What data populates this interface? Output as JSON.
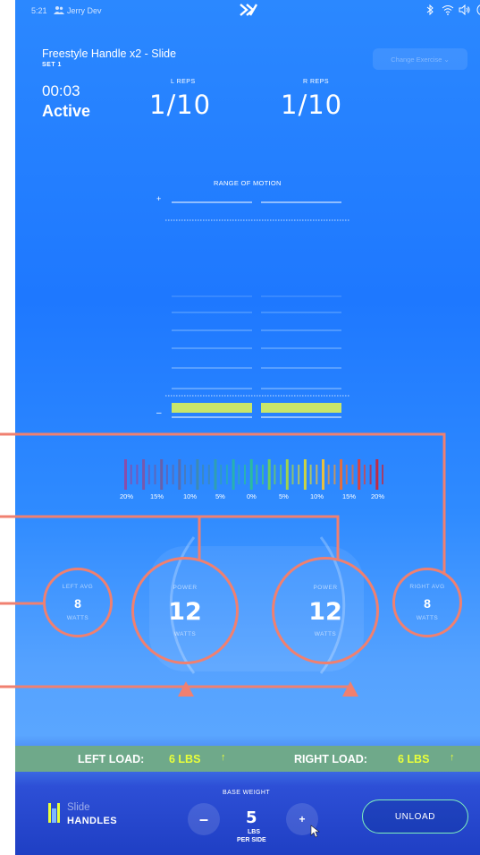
{
  "status_bar": {
    "time": "5:21",
    "user": "Jerry Dev",
    "logo": "X-logo",
    "icons": [
      "bluetooth-icon",
      "wifi-icon",
      "volume-icon",
      "dropdown-circle-icon"
    ]
  },
  "header": {
    "exercise_title": "Freestyle Handle x2 - Slide",
    "set_label": "SET 1",
    "change_exercise": "Change Exercise ⌄",
    "timer": "00:03",
    "state": "Active",
    "left_reps_label": "L REPS",
    "left_reps": "1/10",
    "right_reps_label": "R REPS",
    "right_reps": "1/10"
  },
  "range_of_motion": {
    "title": "RANGE OF MOTION",
    "plus": "+",
    "minus": "–",
    "left_fill": 0.08,
    "right_fill": 0.08
  },
  "balance_scale": {
    "labels": [
      "20%",
      "15%",
      "10%",
      "5%",
      "0%",
      "5%",
      "10%",
      "15%",
      "20%"
    ]
  },
  "metrics": {
    "left_avg": {
      "label": "LEFT AVG",
      "value": "8",
      "unit": "WATTS"
    },
    "left_power": {
      "label": "POWER",
      "value": "12",
      "unit": "WATTS"
    },
    "right_power": {
      "label": "POWER",
      "value": "12",
      "unit": "WATTS"
    },
    "right_avg": {
      "label": "RIGHT AVG",
      "value": "8",
      "unit": "WATTS"
    }
  },
  "load": {
    "left_label": "LEFT LOAD:",
    "left_value": "6 LBS",
    "left_arrow": "↑",
    "right_label": "RIGHT LOAD:",
    "right_value": "6 LBS",
    "right_arrow": "↑"
  },
  "footer": {
    "mode_line1": "Slide",
    "mode_line2": "HANDLES",
    "base_weight_label": "BASE WEIGHT",
    "base_weight_value": "5",
    "unit_line1": "LBS",
    "unit_line2": "PER SIDE",
    "minus": "–",
    "plus": "+",
    "unload": "UNLOAD"
  },
  "colors": {
    "accent_yellow": "#e9ff3a",
    "annotation": "#f08070",
    "rom_fill": "#c8e66a",
    "unload_border": "#7ff0bd",
    "load_bar": "#6fa98a"
  }
}
